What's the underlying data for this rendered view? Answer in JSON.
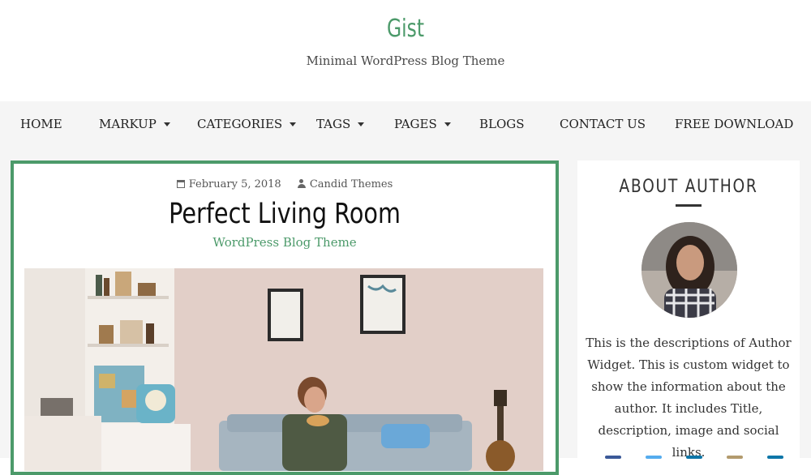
{
  "site": {
    "title": "Gist",
    "tagline": "Minimal WordPress Blog Theme",
    "accent": "#4c9a6a"
  },
  "nav": {
    "items": [
      {
        "label": "HOME",
        "dropdown": false
      },
      {
        "label": "MARKUP",
        "dropdown": true
      },
      {
        "label": "CATEGORIES",
        "dropdown": true
      },
      {
        "label": "TAGS",
        "dropdown": true
      },
      {
        "label": "PAGES",
        "dropdown": true
      },
      {
        "label": "BLOGS",
        "dropdown": false
      },
      {
        "label": "CONTACT US",
        "dropdown": false
      },
      {
        "label": "FREE DOWNLOAD",
        "dropdown": false
      }
    ]
  },
  "post": {
    "date": "February 5, 2018",
    "author": "Candid Themes",
    "title": "Perfect Living Room",
    "category": "WordPress Blog Theme",
    "image_alt": "Young man eating pizza on a sofa in a living room"
  },
  "sidebar": {
    "widget_title": "ABOUT AUTHOR",
    "bio": "This is the descriptions of Author Widget. This is custom widget to show the information about the author. It includes Title, description, image and social links.",
    "social_icons": [
      "facebook-icon",
      "twitter-icon",
      "linkedin-icon",
      "instagram-icon",
      "youtube-icon"
    ]
  }
}
